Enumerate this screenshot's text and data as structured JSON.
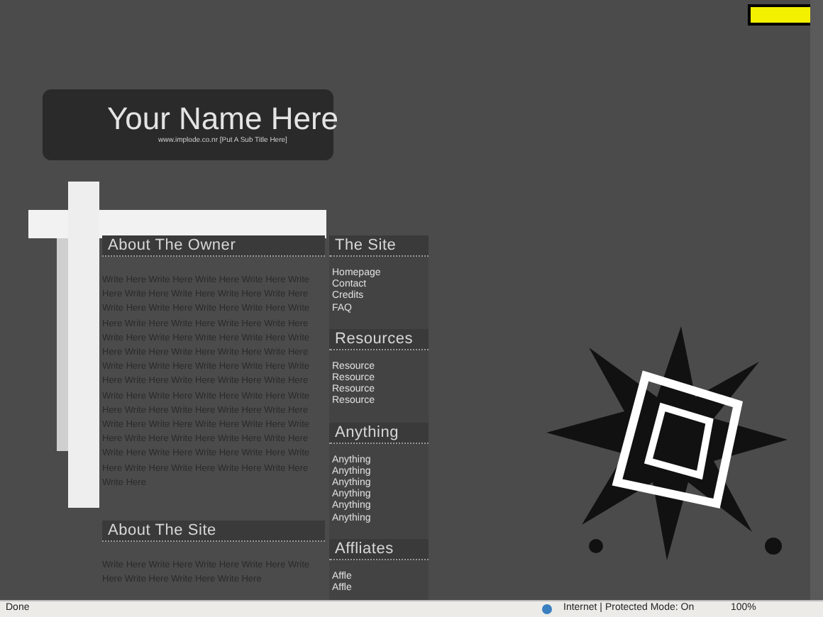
{
  "header": {
    "title": "Your Name Here",
    "subtitle": "www.implode.co.nr [Put A Sub Title Here]"
  },
  "main_sections": [
    {
      "heading": "About The Owner",
      "text": "Write Here Write Here Write Here Write Here Write Here Write Here Write Here Write Here Write Here Write Here Write Here Write Here Write Here Write Here Write Here Write Here Write Here Write Here Write Here Write Here Write Here Write Here Write Here Write Here Write Here Write Here Write Here Write Here Write Here Write Here Write Here Write Here Write Here Write Here Write Here Write Here Write Here Write Here Write Here Write Here Write Here Write Here Write Here Write Here Write Here Write Here Write Here Write Here Write Here Write Here Write Here Write Here Write Here Write Here Write Here Write Here Write Here Write Here Write Here Write Here Write Here Write Here Write Here Write Here"
    },
    {
      "heading": "About The Site",
      "text": "Write Here Write Here Write Here Write Here Write Here Write Here Write Here Write Here"
    }
  ],
  "side_sections": [
    {
      "heading": "The Site",
      "links": [
        "Homepage",
        "Contact",
        "Credits",
        "FAQ"
      ]
    },
    {
      "heading": "Resources",
      "links": [
        "Resource",
        "Resource",
        "Resource",
        "Resource"
      ]
    },
    {
      "heading": "Anything",
      "links": [
        "Anything",
        "Anything",
        "Anything",
        "Anything",
        "Anything",
        "Anything"
      ]
    },
    {
      "heading": "Affliates",
      "links": [
        "Affle",
        "Affle"
      ]
    }
  ],
  "status_bar": {
    "status": "Done",
    "zone": "Internet | Protected Mode: On",
    "zoom": "100%"
  }
}
